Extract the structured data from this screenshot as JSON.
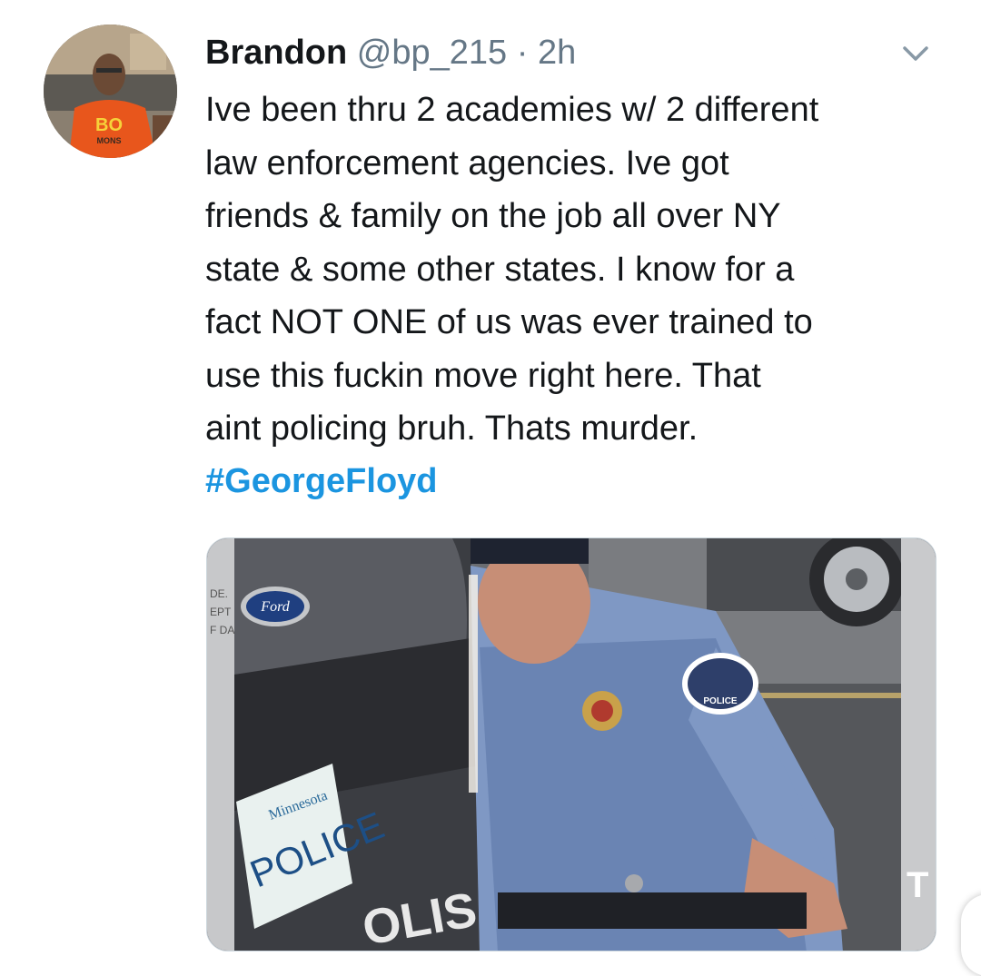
{
  "tweet": {
    "author": {
      "name": "Brandon",
      "handle": "@bp_215",
      "separator": "·",
      "time": "2h"
    },
    "text": "Ive been thru 2 academies w/ 2 different\nlaw enforcement agencies. Ive got\nfriends & family on the job all over NY\nstate & some other states. I know for a\nfact NOT ONE of us was ever trained to\nuse this fuckin move right here. That\naint policing bruh. Thats murder.",
    "hashtag": "#GeorgeFloyd",
    "media": {
      "plate_state": "Minnesota",
      "plate_text": "POLICE",
      "car_text": "OLIS",
      "badge_text": "POLICE",
      "right_edge_text": "T"
    },
    "icons": {
      "menu": "chevron-down-icon",
      "avatar": "user-avatar"
    }
  },
  "colors": {
    "text": "#14171a",
    "secondary": "#657786",
    "link": "#1b95e0",
    "border": "#ccd6dd"
  }
}
